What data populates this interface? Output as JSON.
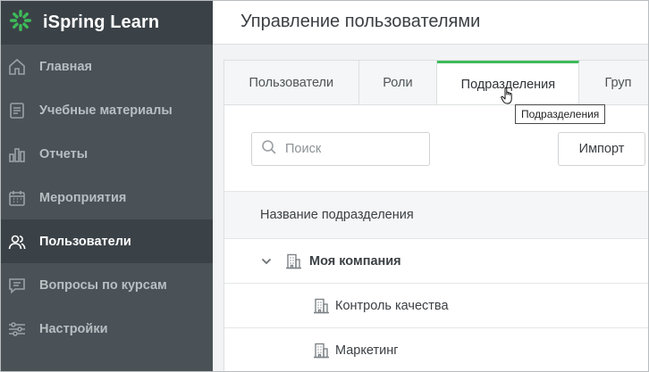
{
  "brand": {
    "name": "iSpring Learn",
    "logo_color": "#3dba58"
  },
  "sidebar": {
    "items": [
      {
        "label": "Главная",
        "icon": "home-icon",
        "active": false
      },
      {
        "label": "Учебные материалы",
        "icon": "course-materials-icon",
        "active": false
      },
      {
        "label": "Отчеты",
        "icon": "bar-chart-icon",
        "active": false
      },
      {
        "label": "Мероприятия",
        "icon": "calendar-icon",
        "active": false
      },
      {
        "label": "Пользователи",
        "icon": "users-icon",
        "active": true
      },
      {
        "label": "Вопросы по курсам",
        "icon": "chat-icon",
        "active": false
      },
      {
        "label": "Настройки",
        "icon": "sliders-icon",
        "active": false
      }
    ]
  },
  "header": {
    "title": "Управление пользователями"
  },
  "tabs": [
    {
      "label": "Пользователи",
      "active": false
    },
    {
      "label": "Роли",
      "active": false
    },
    {
      "label": "Подразделения",
      "active": true
    },
    {
      "label": "Груп",
      "active": false
    }
  ],
  "toolbar": {
    "search_placeholder": "Поиск",
    "import_label": "Импорт"
  },
  "table": {
    "column_header": "Название подразделения",
    "rows": [
      {
        "label": "Моя компания",
        "level": 0,
        "expanded": true
      },
      {
        "label": "Контроль качества",
        "level": 1
      },
      {
        "label": "Маркетинг",
        "level": 1
      }
    ]
  },
  "tooltip": {
    "text": "Подразделения"
  },
  "colors": {
    "sidebar_bg": "#4a5257",
    "sidebar_active_bg": "#3b4247",
    "accent": "#3dba58"
  }
}
